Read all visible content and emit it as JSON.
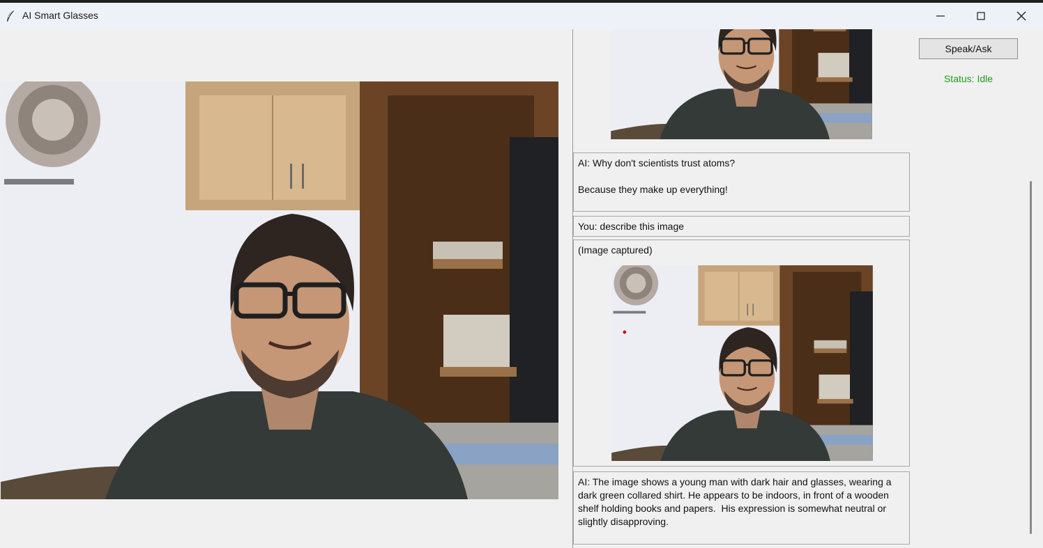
{
  "window": {
    "title": "AI Smart Glasses",
    "icon": "feather-icon",
    "controls": [
      "minimize-icon",
      "maximize-icon",
      "close-icon"
    ]
  },
  "chat": {
    "joke_message": "AI: Why don't scientists trust atoms?\n\nBecause they make up everything!",
    "user_message": "You: describe this image",
    "captured_label": "(Image captured)",
    "ai_description": "AI: The image shows a young man with dark hair and glasses, wearing a dark green collared shirt. He appears to be indoors, in front of a wooden shelf holding books and papers.  His expression is somewhat neutral or slightly disapproving."
  },
  "controls": {
    "speak_button": "Speak/Ask",
    "status": "Status: Idle"
  },
  "colors": {
    "status_text": "#1e9b1e",
    "window_bg": "#f0f0f0",
    "titlebar_bg": "#eef1f7"
  }
}
